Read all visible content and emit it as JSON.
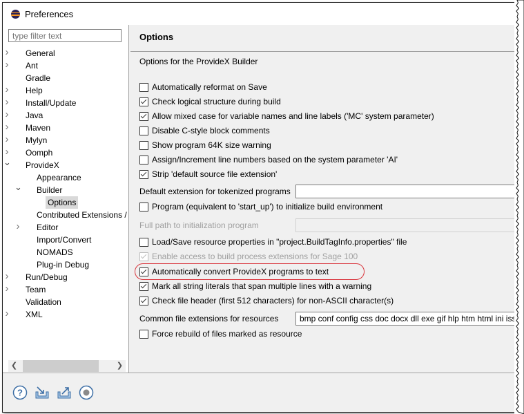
{
  "window": {
    "title": "Preferences"
  },
  "filter": {
    "placeholder": "type filter text"
  },
  "tree": [
    {
      "label": "General",
      "level": 0,
      "expander": "collapsed"
    },
    {
      "label": "Ant",
      "level": 0,
      "expander": "collapsed"
    },
    {
      "label": "Gradle",
      "level": 0,
      "expander": "none"
    },
    {
      "label": "Help",
      "level": 0,
      "expander": "collapsed"
    },
    {
      "label": "Install/Update",
      "level": 0,
      "expander": "collapsed"
    },
    {
      "label": "Java",
      "level": 0,
      "expander": "collapsed"
    },
    {
      "label": "Maven",
      "level": 0,
      "expander": "collapsed"
    },
    {
      "label": "Mylyn",
      "level": 0,
      "expander": "collapsed"
    },
    {
      "label": "Oomph",
      "level": 0,
      "expander": "collapsed"
    },
    {
      "label": "ProvideX",
      "level": 0,
      "expander": "expanded"
    },
    {
      "label": "Appearance",
      "level": 1,
      "expander": "none"
    },
    {
      "label": "Builder",
      "level": 1,
      "expander": "expanded"
    },
    {
      "label": "Options",
      "level": 2,
      "expander": "none",
      "selected": true
    },
    {
      "label": "Contributed Extensions /",
      "level": 1,
      "expander": "none"
    },
    {
      "label": "Editor",
      "level": 1,
      "expander": "collapsed"
    },
    {
      "label": "Import/Convert",
      "level": 1,
      "expander": "none"
    },
    {
      "label": "NOMADS",
      "level": 1,
      "expander": "none"
    },
    {
      "label": "Plug-in Debug",
      "level": 1,
      "expander": "none"
    },
    {
      "label": "Run/Debug",
      "level": 0,
      "expander": "collapsed"
    },
    {
      "label": "Team",
      "level": 0,
      "expander": "collapsed"
    },
    {
      "label": "Validation",
      "level": 0,
      "expander": "none"
    },
    {
      "label": "XML",
      "level": 0,
      "expander": "collapsed"
    }
  ],
  "page": {
    "title": "Options",
    "description": "Options for the ProvideX Builder",
    "options": [
      {
        "label": "Automatically reformat on Save",
        "checked": false
      },
      {
        "label": "Check logical structure during build",
        "checked": true
      },
      {
        "label": "Allow mixed case for variable names and line labels ('MC' system parameter)",
        "checked": true
      },
      {
        "label": "Disable C-style block comments",
        "checked": false
      },
      {
        "label": "Show program 64K size warning",
        "checked": false
      },
      {
        "label": "Assign/Increment line numbers based on the system parameter 'AI'",
        "checked": false
      },
      {
        "label": "Strip 'default source file extension'",
        "checked": true
      }
    ],
    "default_ext_label": "Default extension for tokenized programs",
    "default_ext_value": "",
    "startup_program": {
      "label": "Program (equivalent to 'start_up') to initialize build environment",
      "checked": false
    },
    "init_path_label": "Full path to initialization program",
    "init_path_value": "",
    "options2": [
      {
        "label": "Load/Save resource properties in \"project.BuildTagInfo.properties\" file",
        "checked": false,
        "disabled": false
      },
      {
        "label": "Enable access to build process extensions for Sage 100",
        "checked": true,
        "disabled": true
      },
      {
        "label": "Automatically convert ProvideX programs to text",
        "checked": true,
        "disabled": false,
        "highlighted": true
      },
      {
        "label": "Mark all string literals that span multiple lines with a warning",
        "checked": true,
        "disabled": false
      },
      {
        "label": "Check file header (first 512 characters) for non-ASCII character(s)",
        "checked": true,
        "disabled": false
      }
    ],
    "resource_ext_label": "Common file extensions for resources",
    "resource_ext_value": "bmp conf config css doc docx dll exe gif hlp htm html ini iss",
    "force_rebuild": {
      "label": "Force rebuild of files marked as resource",
      "checked": false
    }
  },
  "footer": {
    "icons": [
      "help-icon",
      "import-icon",
      "export-icon",
      "record-icon"
    ]
  },
  "colors": {
    "highlight": "#d9343b",
    "selection": "#d9d9d9"
  }
}
